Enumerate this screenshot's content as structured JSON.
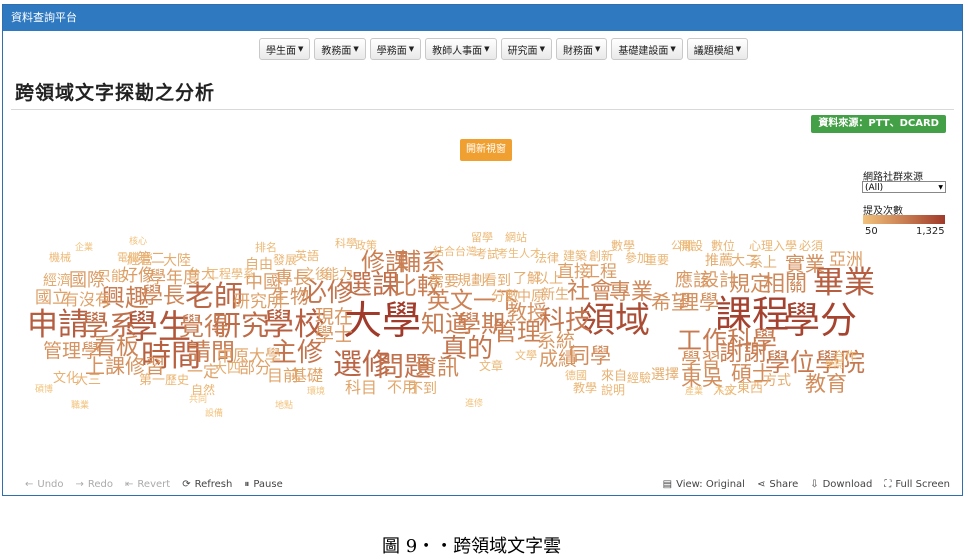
{
  "app": {
    "title": "資料查詢平台"
  },
  "menu": [
    {
      "label": "學生面"
    },
    {
      "label": "教務面"
    },
    {
      "label": "學務面"
    },
    {
      "label": "教師人事面"
    },
    {
      "label": "研究面"
    },
    {
      "label": "財務面"
    },
    {
      "label": "基礎建設面"
    },
    {
      "label": "議題模組"
    }
  ],
  "page_title": "跨領域文字探勘之分析",
  "source_badge": "資料來源：PTT、DCARD",
  "open_new_window": "開新視窗",
  "filter": {
    "label": "網路社群來源",
    "value": "(All)"
  },
  "legend": {
    "label": "提及次數",
    "min": "50",
    "max": "1,325",
    "color_min": "#f2c27b",
    "color_max": "#a03a2a"
  },
  "toolbar": {
    "undo": "Undo",
    "redo": "Redo",
    "revert": "Revert",
    "refresh": "Refresh",
    "pause": "Pause",
    "view": "View: Original",
    "share": "Share",
    "download": "Download",
    "fullscreen": "Full Screen"
  },
  "caption": "圖 9‧‧跨領域文字雲",
  "words": [
    {
      "text": "大學",
      "count": 1325
    },
    {
      "text": "課程",
      "count": 1180
    },
    {
      "text": "學分",
      "count": 1150
    },
    {
      "text": "領域",
      "count": 1000
    },
    {
      "text": "學生",
      "count": 860
    },
    {
      "text": "申請",
      "count": 760
    },
    {
      "text": "畢業",
      "count": 740
    },
    {
      "text": "學校",
      "count": 720
    },
    {
      "text": "時間",
      "count": 700
    },
    {
      "text": "選修",
      "count": 640
    },
    {
      "text": "老師",
      "count": 620
    },
    {
      "text": "研究",
      "count": 560
    },
    {
      "text": "學系",
      "count": 540
    },
    {
      "text": "選課",
      "count": 520
    },
    {
      "text": "問題",
      "count": 500
    },
    {
      "text": "真的",
      "count": 470
    },
    {
      "text": "主修",
      "count": 470
    },
    {
      "text": "科技",
      "count": 460
    },
    {
      "text": "必修",
      "count": 450
    },
    {
      "text": "學位學院",
      "count": 420
    },
    {
      "text": "工作科學",
      "count": 410
    },
    {
      "text": "覺得",
      "count": 400
    },
    {
      "text": "知道",
      "count": 390
    },
    {
      "text": "學期",
      "count": 390
    },
    {
      "text": "比較",
      "count": 380
    },
    {
      "text": "興趣",
      "count": 380
    },
    {
      "text": "請問",
      "count": 370
    },
    {
      "text": "管理",
      "count": 360
    },
    {
      "text": "修課",
      "count": 360
    },
    {
      "text": "輔系",
      "count": 350
    },
    {
      "text": "謝謝",
      "count": 350
    },
    {
      "text": "英文一下",
      "count": 330
    },
    {
      "text": "社會",
      "count": 320
    },
    {
      "text": "看板",
      "count": 310
    },
    {
      "text": "學長",
      "count": 300
    },
    {
      "text": "資訊",
      "count": 290
    },
    {
      "text": "專業",
      "count": 280
    },
    {
      "text": "相關",
      "count": 280
    },
    {
      "text": "規定",
      "count": 260
    },
    {
      "text": "同學",
      "count": 260
    },
    {
      "text": "碩士",
      "count": 250
    },
    {
      "text": "教育",
      "count": 240
    },
    {
      "text": "東吳",
      "count": 240
    },
    {
      "text": "教授",
      "count": 230
    },
    {
      "text": "實業",
      "count": 230
    },
    {
      "text": "希望",
      "count": 220
    },
    {
      "text": "理學",
      "count": 220
    },
    {
      "text": "學習",
      "count": 220
    },
    {
      "text": "上課修習",
      "count": 210
    },
    {
      "text": "管理學",
      "count": 200
    },
    {
      "text": "生物",
      "count": 200
    },
    {
      "text": "系統",
      "count": 190
    },
    {
      "text": "成績",
      "count": 190
    },
    {
      "text": "學士",
      "count": 180
    },
    {
      "text": "現在",
      "count": 180
    },
    {
      "text": "應該",
      "count": 170
    },
    {
      "text": "設計",
      "count": 170
    },
    {
      "text": "中國",
      "count": 160
    },
    {
      "text": "專長",
      "count": 160
    },
    {
      "text": "國際",
      "count": 160
    },
    {
      "text": "好像",
      "count": 150
    },
    {
      "text": "學年度",
      "count": 150
    },
    {
      "text": "工程",
      "count": 150
    },
    {
      "text": "直接",
      "count": 140
    },
    {
      "text": "亞洲",
      "count": 140
    },
    {
      "text": "研究所",
      "count": 130
    },
    {
      "text": "國立",
      "count": 130
    },
    {
      "text": "有沒有",
      "count": 120
    },
    {
      "text": "部分",
      "count": 120
    },
    {
      "text": "一定",
      "count": 120
    },
    {
      "text": "中原大學",
      "count": 110
    },
    {
      "text": "目前",
      "count": 110
    },
    {
      "text": "基礎",
      "count": 110
    },
    {
      "text": "科目",
      "count": 110
    },
    {
      "text": "不用",
      "count": 100
    },
    {
      "text": "不到",
      "count": 90
    },
    {
      "text": "需要",
      "count": 100
    },
    {
      "text": "規劃",
      "count": 90
    },
    {
      "text": "看到",
      "count": 80
    },
    {
      "text": "了解",
      "count": 80
    },
    {
      "text": "以上",
      "count": 80
    },
    {
      "text": "新生",
      "count": 90
    },
    {
      "text": "中原",
      "count": 90
    },
    {
      "text": "分數",
      "count": 80
    },
    {
      "text": "經濟",
      "count": 90
    },
    {
      "text": "只能",
      "count": 90
    },
    {
      "text": "第二",
      "count": 90
    },
    {
      "text": "大陸",
      "count": 80
    },
    {
      "text": "自由",
      "count": 80
    },
    {
      "text": "能力",
      "count": 90
    },
    {
      "text": "之後",
      "count": 80
    },
    {
      "text": "經營",
      "count": 70
    },
    {
      "text": "台大",
      "count": 80
    },
    {
      "text": "工程學系",
      "count": 60
    },
    {
      "text": "發展",
      "count": 60
    },
    {
      "text": "推薦",
      "count": 80
    },
    {
      "text": "大二",
      "count": 80
    },
    {
      "text": "系上",
      "count": 90
    },
    {
      "text": "方式",
      "count": 80
    },
    {
      "text": "文化",
      "count": 70
    },
    {
      "text": "大三",
      "count": 70
    },
    {
      "text": "第一",
      "count": 70
    },
    {
      "text": "歷史",
      "count": 60
    },
    {
      "text": "大四",
      "count": 80
    },
    {
      "text": "來自",
      "count": 70
    },
    {
      "text": "經驗",
      "count": 60
    },
    {
      "text": "選擇",
      "count": 80
    },
    {
      "text": "東西",
      "count": 70
    },
    {
      "text": "人文",
      "count": 60
    },
    {
      "text": "自然",
      "count": 60
    },
    {
      "text": "說明",
      "count": 60
    },
    {
      "text": "教學",
      "count": 60
    },
    {
      "text": "必須",
      "count": 60
    },
    {
      "text": "英語",
      "count": 60
    },
    {
      "text": "創新",
      "count": 60
    },
    {
      "text": "建築",
      "count": 60
    },
    {
      "text": "合作",
      "count": 60
    },
    {
      "text": "數位",
      "count": 60
    },
    {
      "text": "心理",
      "count": 60
    },
    {
      "text": "入學",
      "count": 60
    },
    {
      "text": "參加",
      "count": 60
    },
    {
      "text": "重要",
      "count": 60
    },
    {
      "text": "文章",
      "count": 60
    },
    {
      "text": "考試",
      "count": 60
    },
    {
      "text": "法律",
      "count": 60
    },
    {
      "text": "數學",
      "count": 60
    },
    {
      "text": "開設",
      "count": 60
    },
    {
      "text": "留學",
      "count": 55
    },
    {
      "text": "網站",
      "count": 55
    },
    {
      "text": "文學",
      "count": 55
    },
    {
      "text": "德國",
      "count": 55
    },
    {
      "text": "公開",
      "count": 55
    },
    {
      "text": "排名",
      "count": 55
    },
    {
      "text": "機械",
      "count": 55
    },
    {
      "text": "電腦",
      "count": 55
    },
    {
      "text": "科學",
      "count": 55
    },
    {
      "text": "政策",
      "count": 55
    },
    {
      "text": "台灣",
      "count": 55
    },
    {
      "text": "考生",
      "count": 55
    },
    {
      "text": "人才",
      "count": 55
    },
    {
      "text": "結合",
      "count": 55
    },
    {
      "text": "企業",
      "count": 50
    },
    {
      "text": "核心",
      "count": 50
    },
    {
      "text": "產業",
      "count": 50
    },
    {
      "text": "共同",
      "count": 50
    },
    {
      "text": "環境",
      "count": 50
    },
    {
      "text": "碩博",
      "count": 50
    },
    {
      "text": "設備",
      "count": 50
    },
    {
      "text": "職業",
      "count": 50
    },
    {
      "text": "學院",
      "count": 50
    },
    {
      "text": "不分",
      "count": 50
    },
    {
      "text": "地點",
      "count": 50
    },
    {
      "text": "進修",
      "count": 50
    }
  ]
}
